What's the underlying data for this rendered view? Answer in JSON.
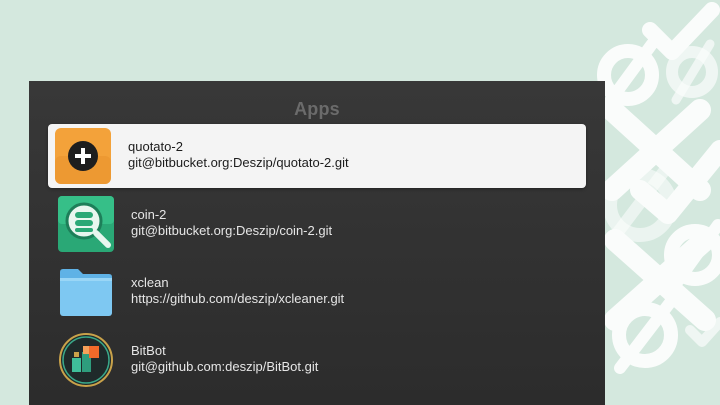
{
  "panel": {
    "title": "Apps"
  },
  "apps": [
    {
      "name": "quotato-2",
      "url": "git@bitbucket.org:Deszip/quotato-2.git",
      "icon": "plus-circle-icon",
      "selected": true
    },
    {
      "name": "coin-2",
      "url": "git@bitbucket.org:Deszip/coin-2.git",
      "icon": "coin-magnifier-icon",
      "selected": false
    },
    {
      "name": "xclean",
      "url": "https://github.com/deszip/xcleaner.git",
      "icon": "folder-icon",
      "selected": false
    },
    {
      "name": "BitBot",
      "url": "git@github.com:deszip/BitBot.git",
      "icon": "bitbot-icon",
      "selected": false
    }
  ],
  "colors": {
    "background": "#d4e8de",
    "panel": "#333333",
    "selected_row": "#f4f4f4",
    "accent_orange": "#f3a23a"
  }
}
